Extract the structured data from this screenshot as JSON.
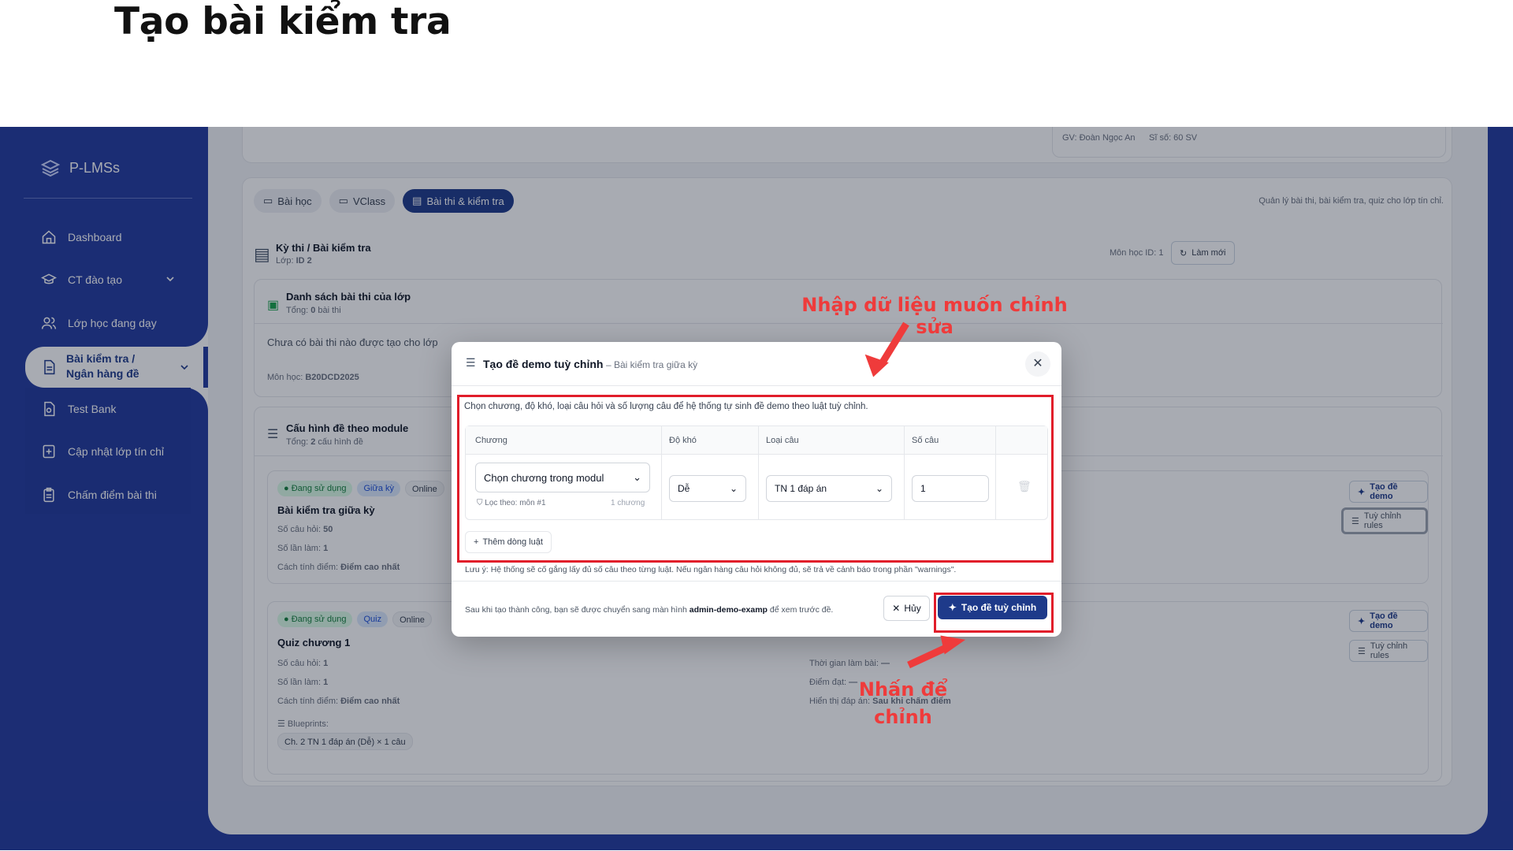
{
  "page_title": "Tạo bài kiểm tra",
  "sidebar": {
    "brand": "P-LMSs",
    "items": [
      {
        "label": "Dashboard"
      },
      {
        "label": "CT đào tạo"
      },
      {
        "label": "Lớp học đang dạy"
      },
      {
        "label": "Bài kiểm tra /\nNgân hàng đề"
      },
      {
        "label": "Test Bank"
      },
      {
        "label": "Cập nhật lớp tín chỉ"
      },
      {
        "label": "Chấm điểm bài thi"
      }
    ]
  },
  "top_card": {
    "teacher": "GV: Đoàn Ngọc An",
    "size": "Sĩ số: 60 SV"
  },
  "tabs": [
    {
      "label": "Bài học"
    },
    {
      "label": "VClass"
    },
    {
      "label": "Bài thi & kiểm tra"
    }
  ],
  "tabs_hint": "Quản lý bài thi, bài kiểm tra, quiz cho lớp tín chỉ.",
  "exam": {
    "title": "Kỳ thi / Bài kiểm tra",
    "class_prefix": "Lớp:",
    "class_id": "ID 2",
    "course_id": "Môn học ID: 1",
    "refresh": "Làm mới",
    "list_title": "Danh sách bài thi của lớp",
    "list_count_prefix": "Tổng:",
    "list_count": "0",
    "list_count_suffix": "bài thi",
    "empty": "Chưa có bài thi nào được tạo cho lớp",
    "course_code_label": "Môn học:",
    "course_code": "B20DCD2025",
    "config_title": "Cấu hình đề theo module",
    "config_count_prefix": "Tổng:",
    "config_count": "2",
    "config_count_suffix": "cấu hình đề"
  },
  "configs": [
    {
      "status": "Đang sử dụng",
      "type": "Giữa kỳ",
      "mode": "Online",
      "name": "Bài kiểm tra giữa kỳ",
      "q_label": "Số câu hỏi:",
      "q": "50",
      "t_label": "Số lần làm:",
      "t": "1",
      "g_label": "Cách tính điểm:",
      "g": "Điểm cao nhất",
      "demo": "Tạo đề demo",
      "rules": "Tuỳ chỉnh rules"
    },
    {
      "status": "Đang sử dụng",
      "type": "Quiz",
      "mode": "Online",
      "name": "Quiz chương 1",
      "q_label": "Số câu hỏi:",
      "q": "1",
      "t_label": "Số lần làm:",
      "t": "1",
      "g_label": "Cách tính điểm:",
      "g": "Điểm cao nhất",
      "time_label": "Thời gian làm bài:",
      "time": "—",
      "pass_label": "Điểm đạt:",
      "pass": "—",
      "show_label": "Hiển thị đáp án:",
      "show": "Sau khi chấm điểm",
      "bp_label": "Blueprints:",
      "bp": "Ch.  2 TN 1 đáp án (Dễ) × 1 câu",
      "demo": "Tạo đề demo",
      "rules": "Tuỳ chỉnh rules"
    }
  ],
  "modal": {
    "title": "Tạo đề demo tuỳ chỉnh",
    "subtitle": "– Bài kiểm tra giữa kỳ",
    "desc": "Chọn chương, độ khó, loại câu hỏi và số lượng câu để hệ thống tự sinh đề demo theo luật tuỳ chỉnh.",
    "cols": [
      "Chương",
      "Độ khó",
      "Loại câu",
      "Số câu"
    ],
    "row": {
      "chapter": "Chọn chương trong modul",
      "filter": "Lọc theo: môn #1",
      "chapter_count": "1 chương",
      "difficulty": "Dễ",
      "qtype": "TN 1 đáp án",
      "count": "1"
    },
    "add_rule": "Thêm dòng luật",
    "note": "Lưu ý: Hệ thống sẽ cố gắng lấy đủ số câu theo từng luật. Nếu ngân hàng câu hỏi không đủ, sẽ trả về cảnh báo trong phần \"warnings\".",
    "footer_pre": "Sau khi tạo thành công, bạn sẽ được chuyển sang màn hình",
    "footer_screen": "admin-demo-examp",
    "footer_post": "để xem trước đề.",
    "cancel": "Hủy",
    "submit": "Tạo đề tuỳ chỉnh"
  },
  "annotations": {
    "top": "Nhập dữ liệu muốn chỉnh sửa",
    "bottom": "Nhấn để\nchỉnh",
    "color": "#ef3b3b"
  }
}
